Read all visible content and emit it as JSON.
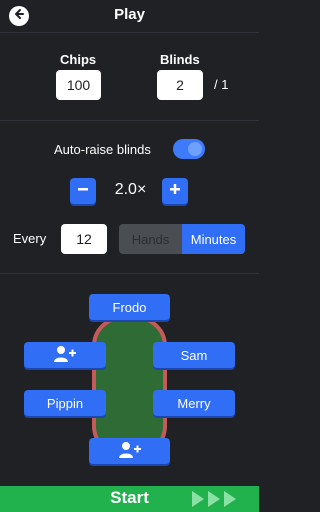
{
  "header": {
    "title": "Play",
    "back_icon": "back-arrow-icon"
  },
  "chips": {
    "label": "Chips",
    "value": "100"
  },
  "blinds": {
    "label": "Blinds",
    "value": "2",
    "suffix": "/ 1"
  },
  "auto_raise": {
    "label": "Auto-raise blinds",
    "enabled": true
  },
  "multiplier": {
    "value": "2.0×",
    "minus": "−",
    "plus": "+"
  },
  "every": {
    "label": "Every",
    "value": "12",
    "options": [
      "Hands",
      "Minutes"
    ],
    "selected": "Minutes"
  },
  "seats": {
    "top": "Frodo",
    "left_upper_icon": "add-player-icon",
    "right_upper": "Sam",
    "left_lower": "Pippin",
    "right_lower": "Merry",
    "bottom_icon": "add-player-icon"
  },
  "start": {
    "label": "Start"
  },
  "colors": {
    "accent": "#2f6ef5",
    "start": "#21b24d",
    "bg": "#1f2125"
  }
}
